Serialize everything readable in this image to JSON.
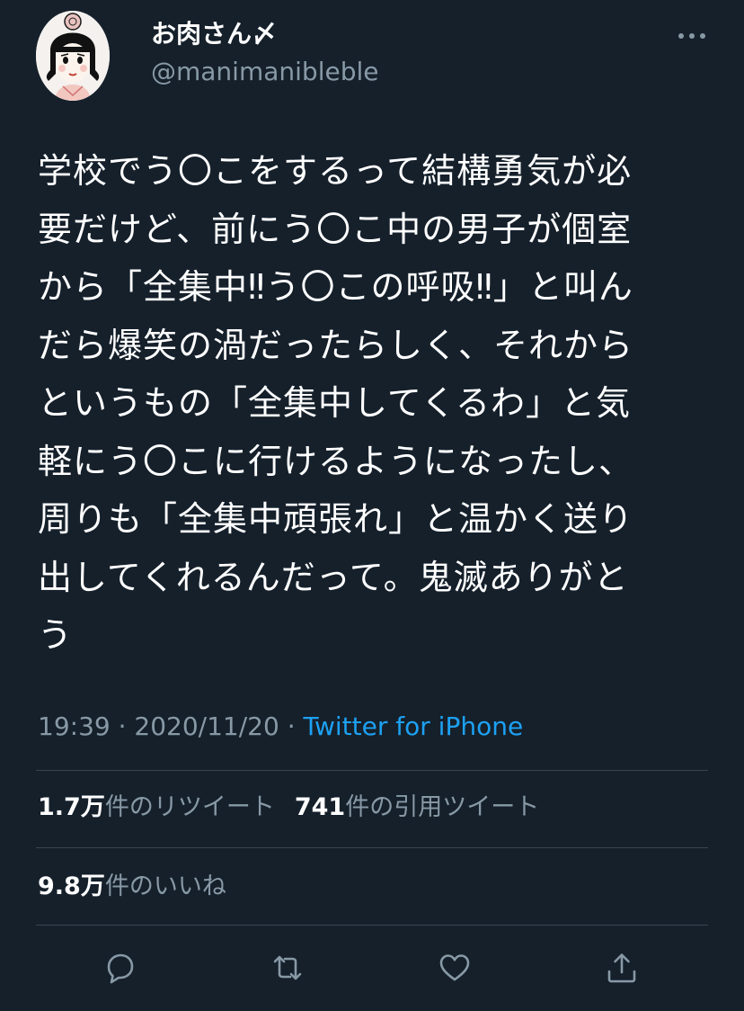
{
  "user": {
    "display_name": "お肉さん〆",
    "handle": "@manimanibleble",
    "avatar_icon": "avatar-illustration"
  },
  "tweet": {
    "lines": [
      "学校でう〇こをするって結構勇気が必",
      "要だけど、前にう〇こ中の男子が個室",
      "から「全集中‼う〇この呼吸‼」と叫ん",
      "だら爆笑の渦だったらしく、それから",
      "というもの「全集中してくるわ」と気",
      "軽にう〇こに行けるようになったし、",
      "周りも「全集中頑張れ」と温かく送り",
      "出してくれるんだって。鬼滅ありがと",
      "う"
    ]
  },
  "meta": {
    "time": "19:39",
    "separator": "·",
    "date": "2020/11/20",
    "source": "Twitter for iPhone"
  },
  "stats": {
    "retweets_count": "1.7万",
    "retweets_label": "件のリツイート",
    "quotes_count": "741",
    "quotes_label": "件の引用ツイート",
    "likes_count": "9.8万",
    "likes_label": "件のいいね"
  },
  "colors": {
    "background": "#15202b",
    "text_primary": "#ffffff",
    "text_secondary": "#8899a6",
    "link": "#1da1f2",
    "divider": "#38444d"
  },
  "icons": {
    "more": "more-icon",
    "reply": "reply-icon",
    "retweet": "retweet-icon",
    "like": "heart-icon",
    "share": "share-icon"
  }
}
